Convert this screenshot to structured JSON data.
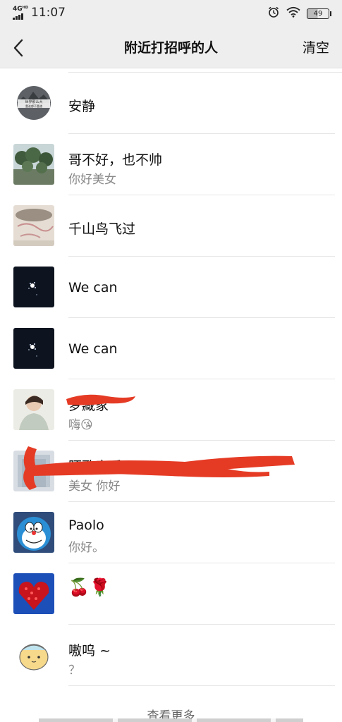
{
  "status_bar": {
    "network_label": "4G",
    "network_sub": "HD",
    "time": "11:07",
    "battery": "49"
  },
  "header": {
    "title": "附近打招呼的人",
    "clear_label": "清空"
  },
  "rows": [
    {
      "name": "安静",
      "message": "",
      "avatar_text_1": "世界那么大",
      "avatar_text_2": "靠谁都不靠谱"
    },
    {
      "name": "哥不好，也不帅",
      "message": "你好美女"
    },
    {
      "name": "千山鸟飞过",
      "message": ""
    },
    {
      "name": "We  can",
      "message": ""
    },
    {
      "name": "We  can",
      "message": ""
    },
    {
      "name": "梦藏家",
      "message": "嗨😘"
    },
    {
      "name": "陌歌音乐",
      "message": "美女 你好"
    },
    {
      "name": "Paolo",
      "message": "你好。"
    },
    {
      "name": "🍒🌹",
      "message": ""
    },
    {
      "name": "嗷呜 ~",
      "message": "？"
    }
  ],
  "footer": {
    "more_label": "查看更多"
  },
  "colors": {
    "bar_bg": "#eeeeee",
    "redaction": "#e53b25",
    "separator": "#e6e6e6"
  },
  "icons": [
    "signal-icon",
    "alarm-clock-icon",
    "wifi-icon",
    "battery-icon",
    "back-chevron-icon"
  ]
}
